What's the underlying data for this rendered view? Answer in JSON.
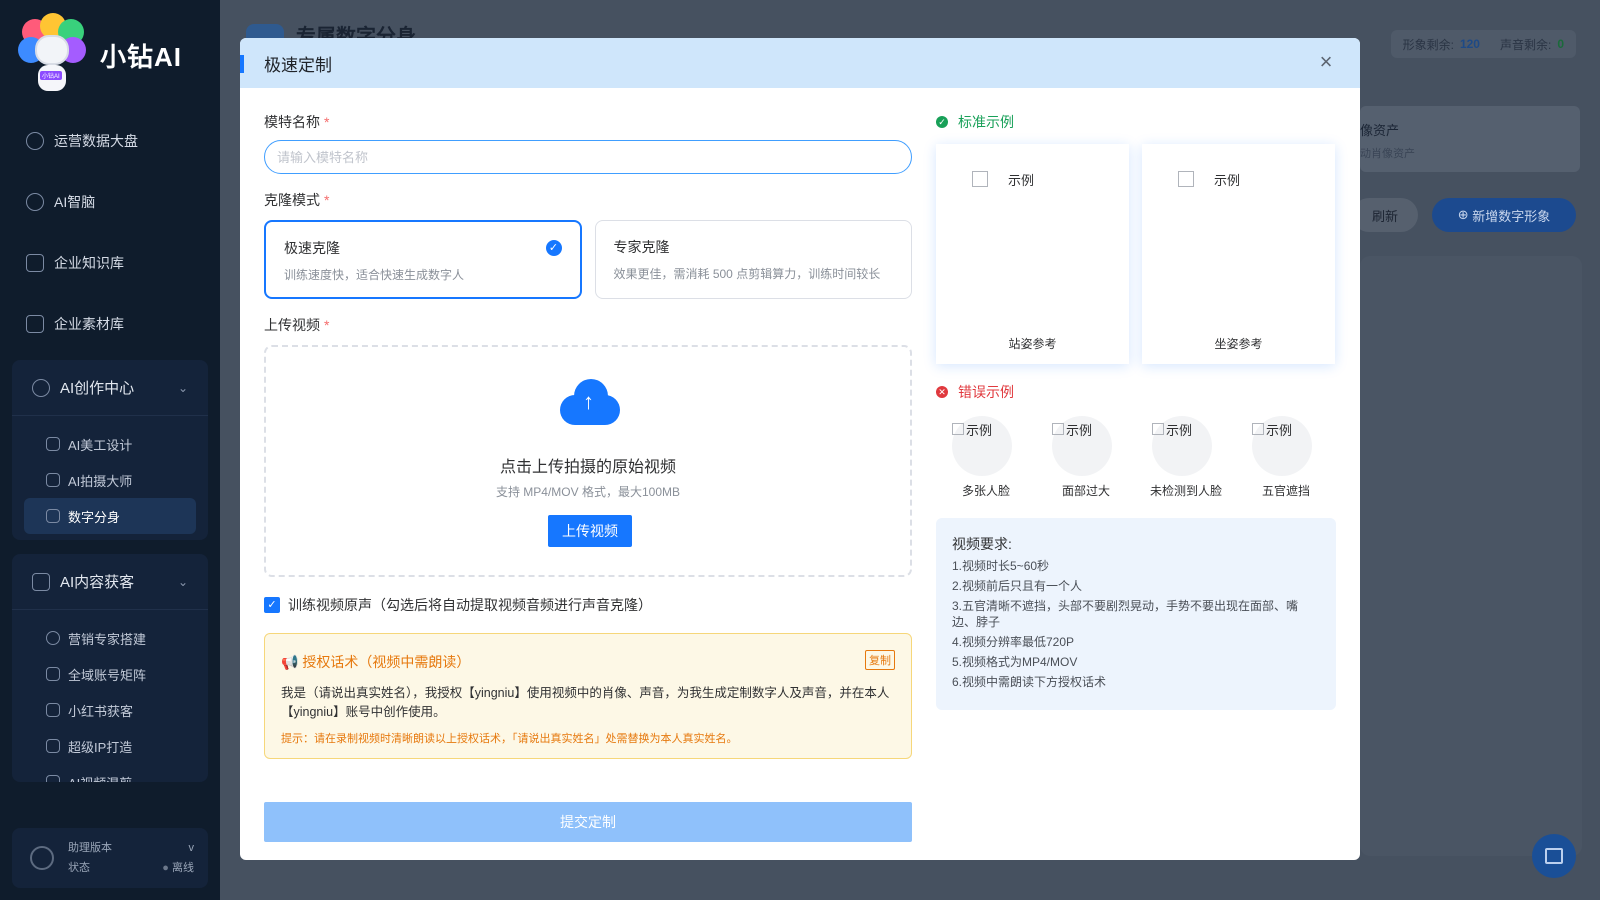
{
  "sidebar": {
    "brand": "小钻AI",
    "logo_tag": "小钻AI",
    "items": [
      {
        "label": "运营数据大盘"
      },
      {
        "label": "AI智脑"
      },
      {
        "label": "企业知识库"
      },
      {
        "label": "企业素材库"
      }
    ],
    "group1": {
      "title": "AI创作中心",
      "items": [
        {
          "label": "AI美工设计"
        },
        {
          "label": "AI拍摄大师"
        },
        {
          "label": "数字分身"
        }
      ]
    },
    "group2": {
      "title": "AI内容获客",
      "items": [
        {
          "label": "营销专家搭建"
        },
        {
          "label": "全域账号矩阵"
        },
        {
          "label": "小红书获客"
        },
        {
          "label": "超级IP打造"
        },
        {
          "label": "AI视频混剪"
        }
      ]
    },
    "status": {
      "version_label": "助理版本",
      "version_value": "v",
      "state_label": "状态",
      "state_value": "离线"
    }
  },
  "background": {
    "page_title": "专属数字分身",
    "quota_image_label": "形象剩余:",
    "quota_image_value": "120",
    "quota_voice_label": "声音剩余:",
    "quota_voice_value": "0",
    "card_title": "像资产",
    "card_sub": "动肖像资产",
    "refresh": "刷新",
    "new_button": "新增数字形象"
  },
  "modal": {
    "title": "极速定制",
    "close": "×",
    "name_label": "模特名称",
    "required_mark": "*",
    "name_placeholder": "请输入模特名称",
    "mode_label": "克隆模式",
    "modes": [
      {
        "title": "极速克隆",
        "desc": "训练速度快，适合快速生成数字人"
      },
      {
        "title": "专家克隆",
        "desc": "效果更佳，需消耗 500 点剪辑算力，训练时间较长"
      }
    ],
    "upload_label": "上传视频",
    "upload_title": "点击上传拍摄的原始视频",
    "upload_sub": "支持 MP4/MOV 格式，最大100MB",
    "upload_button": "上传视频",
    "train_voice": "训练视频原声（勾选后将自动提取视频音频进行声音克隆）",
    "auth_title": "📢 授权话术（视频中需朗读）",
    "copy": "复制",
    "auth_body": "我是（请说出真实姓名），我授权【yingniu】使用视频中的肖像、声音，为我生成定制数字人及声音，并在本人【yingniu】账号中创作使用。",
    "auth_tip": "提示：请在录制视频时清晰朗读以上授权话术，「请说出真实姓名」处需替换为本人真实姓名。",
    "submit": "提交定制",
    "std_title": "标准示例",
    "std_examples": [
      {
        "alt": "示例",
        "caption": "站姿参考"
      },
      {
        "alt": "示例",
        "caption": "坐姿参考"
      }
    ],
    "err_title": "错误示例",
    "err_examples": [
      {
        "alt": "示例",
        "caption": "多张人脸"
      },
      {
        "alt": "示例",
        "caption": "面部过大"
      },
      {
        "alt": "示例",
        "caption": "未检测到人脸"
      },
      {
        "alt": "示例",
        "caption": "五官遮挡"
      }
    ],
    "req_title": "视频要求:",
    "requirements": [
      "1.视频时长5~60秒",
      "2.视频前后只且有一个人",
      "3.五官清晰不遮挡，头部不要剧烈晃动，手势不要出现在面部、嘴边、脖子",
      "4.视频分辨率最低720P",
      "5.视频格式为MP4/MOV",
      "6.视频中需朗读下方授权话术"
    ]
  },
  "colors": {
    "primary": "#1677ff",
    "sidebar_bg": "#0f1c2c",
    "warning": "#e6790e",
    "success": "#18a058",
    "danger": "#e0393e"
  }
}
